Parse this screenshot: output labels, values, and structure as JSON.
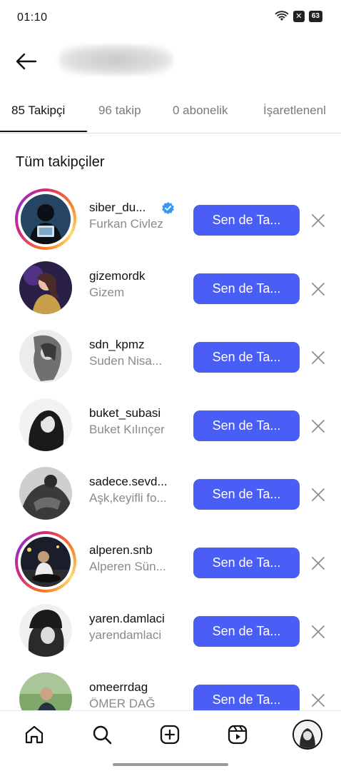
{
  "status_bar": {
    "time": "01:10",
    "battery": "63",
    "icons": [
      "wifi-icon",
      "no-sim-icon",
      "battery-icon"
    ]
  },
  "header": {
    "back_icon": "arrow-left-icon"
  },
  "tabs": [
    {
      "label": "85 Takipçi",
      "active": true
    },
    {
      "label": "96 takip",
      "active": false
    },
    {
      "label": "0 abonelik",
      "active": false
    },
    {
      "label": "İşaretlenenl",
      "active": false
    }
  ],
  "section_title": "Tüm takipçiler",
  "follow_button_label": "Sen de Ta...",
  "followers": [
    {
      "username": "siber_du...",
      "fullname": "Furkan Civlez",
      "verified": true,
      "story_ring": true
    },
    {
      "username": "gizemordk",
      "fullname": "Gizem",
      "verified": false,
      "story_ring": false
    },
    {
      "username": "sdn_kpmz",
      "fullname": "Suden Nisa...",
      "verified": false,
      "story_ring": false
    },
    {
      "username": "buket_subasi",
      "fullname": "Buket Kılınçer",
      "verified": false,
      "story_ring": false
    },
    {
      "username": "sadece.sevd...",
      "fullname": "Aşk,keyifli fo...",
      "verified": false,
      "story_ring": false
    },
    {
      "username": "alperen.snb",
      "fullname": "Alperen Sün...",
      "verified": false,
      "story_ring": true
    },
    {
      "username": "yaren.damlaci",
      "fullname": "yarendamlaci",
      "verified": false,
      "story_ring": false
    },
    {
      "username": "omeerrdag",
      "fullname": "ÖMER DAĞ",
      "verified": false,
      "story_ring": false
    }
  ],
  "bottom_nav": {
    "items": [
      "home-icon",
      "search-icon",
      "create-icon",
      "reels-icon",
      "profile-avatar"
    ]
  },
  "colors": {
    "accent": "#4a5df5",
    "verified": "#3897f0"
  }
}
